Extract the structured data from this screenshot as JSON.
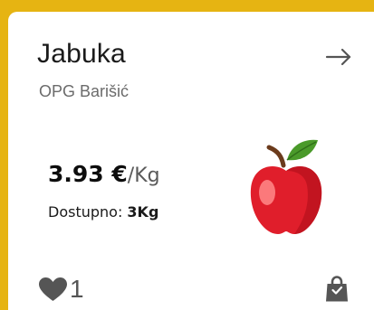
{
  "product": {
    "name": "Jabuka",
    "producer": "OPG Barišić",
    "price_amount": "3.93 €",
    "price_unit": "/Kg",
    "availability_label": "Dostupno: ",
    "availability_qty": "3Kg",
    "image_icon": "apple-icon"
  },
  "actions": {
    "open_icon": "arrow-right-icon",
    "like_icon": "heart-icon",
    "like_count": "1",
    "cart_icon": "shopping-bag-icon"
  },
  "colors": {
    "frame": "#e6b412",
    "card": "#ffffff",
    "icon_gray": "#555555"
  }
}
